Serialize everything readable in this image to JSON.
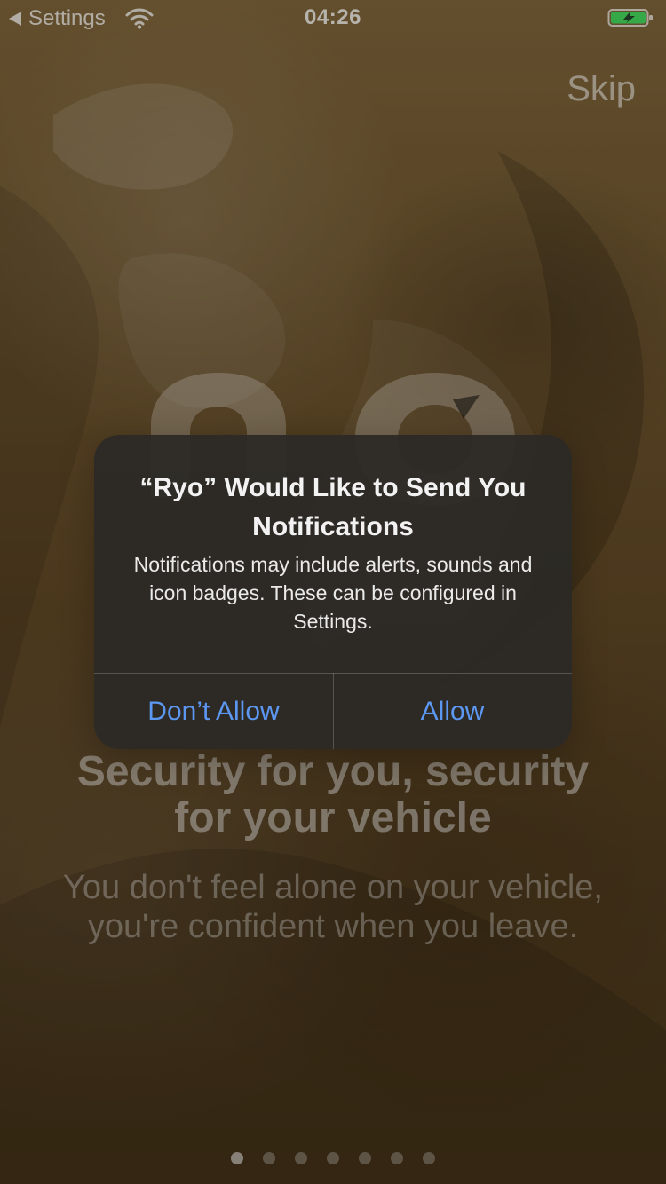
{
  "status_bar": {
    "back_label": "Settings",
    "time": "04:26",
    "icons": [
      "back-triangle-icon",
      "wifi-icon",
      "battery-charging-icon"
    ],
    "battery_color": "#43d35a"
  },
  "top": {
    "skip_label": "Skip"
  },
  "onboarding": {
    "headline": "Security for you, security for your vehicle",
    "subtext": "You don't feel alone on your vehicle, you're confident when you leave.",
    "page_dots": {
      "count": 7,
      "active_index": 0
    }
  },
  "alert": {
    "title": "“Ryo” Would Like to Send You Notifications",
    "message": "Notifications may include alerts, sounds and icon badges. These can be configured in Settings.",
    "buttons": {
      "dont_allow": "Don’t Allow",
      "allow": "Allow"
    },
    "accent_color": "#5c97f2"
  }
}
